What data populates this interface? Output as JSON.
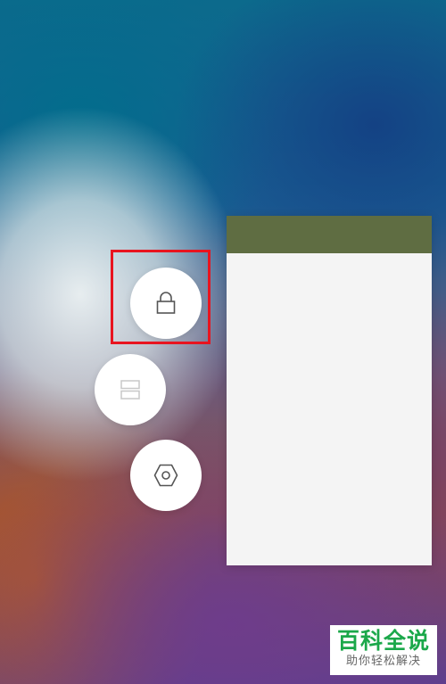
{
  "icons": {
    "lock": "lock-icon",
    "split_screen": "split-screen-icon",
    "settings": "settings-icon"
  },
  "colors": {
    "card_header": "#5f6d42",
    "card_body": "#f4f4f4",
    "button_bg": "#ffffff",
    "icon_stroke_active": "#555555",
    "icon_stroke_disabled": "#c8c8c8",
    "highlight": "#e8141f",
    "watermark_title": "#1ba84a"
  },
  "watermark": {
    "title": "百科全说",
    "subtitle": "助你轻松解决"
  }
}
